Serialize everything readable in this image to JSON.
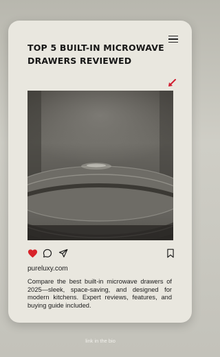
{
  "post": {
    "title": "TOP 5 BUILT-IN MICROWAVE DRAWERS REVIEWED",
    "image_description_icon": "microwave-turntable-photo",
    "domain": "pureluxy.com",
    "description": "Compare the best built-in microwave drawers of 2025—sleek, space-saving, and designed for modern kitchens. Expert reviews, features, and buying guide included."
  },
  "icons": {
    "menu": "menu-icon",
    "arrow": "arrow-icon",
    "like": "heart-icon",
    "comment": "comment-icon",
    "share": "send-icon",
    "save": "bookmark-icon"
  },
  "colors": {
    "like": "#d8232a",
    "arrow": "#d11d2f",
    "card": "#e9e7df"
  },
  "footer": {
    "text": "link in the bio"
  }
}
